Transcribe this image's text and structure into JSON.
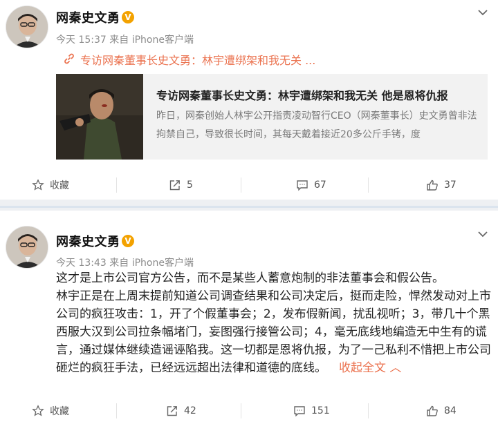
{
  "posts": [
    {
      "author": "网秦史文勇",
      "verified_badge": "V",
      "meta": "今天 15:37 来自 iPhone客户端",
      "link_text": "专访网秦董事长史文勇：林宇遭绑架和我无关 ...",
      "card": {
        "title": "专访网秦董事长史文勇：林宇遭绑架和我无关 他是恩将仇报",
        "desc": "昨日，网秦创始人林宇公开指责凌动智行CEO（网秦董事长）史文勇曾非法拘禁自己，导致很长时间，其每天戴着接近20多公斤手铐，度"
      },
      "actions": {
        "favorite": "收藏",
        "repost": "5",
        "comment": "67",
        "like": "37"
      }
    },
    {
      "author": "网秦史文勇",
      "verified_badge": "V",
      "meta": "今天 13:43 来自 iPhone客户端",
      "paragraphs": [
        "这才是上市公司官方公告，而不是某些人蓄意炮制的非法董事会和假公告。",
        "林宇正是在上周末提前知道公司调查结果和公司决定后，挺而走险，悍然发动对上市公司的疯狂攻击：1，开了个假董事会；2，发布假新闻，扰乱视听；3，带几十个黑西服大汉到公司拉条幅堵门，妄图强行接管公司；4，毫无底线地编造无中生有的谎言，通过媒体继续造谣诬陷我。这一切都是恩将仇报，为了一己私利不惜把上市公司砸烂的疯狂手法，已经远远超出法律和道德的底线。"
      ],
      "collapse_label": "收起全文 ︿",
      "actions": {
        "favorite": "收藏",
        "repost": "42",
        "comment": "151",
        "like": "84"
      }
    }
  ],
  "colors": {
    "accent": "#eb7350",
    "verified": "#f3a200",
    "meta": "#8c8c8c"
  }
}
